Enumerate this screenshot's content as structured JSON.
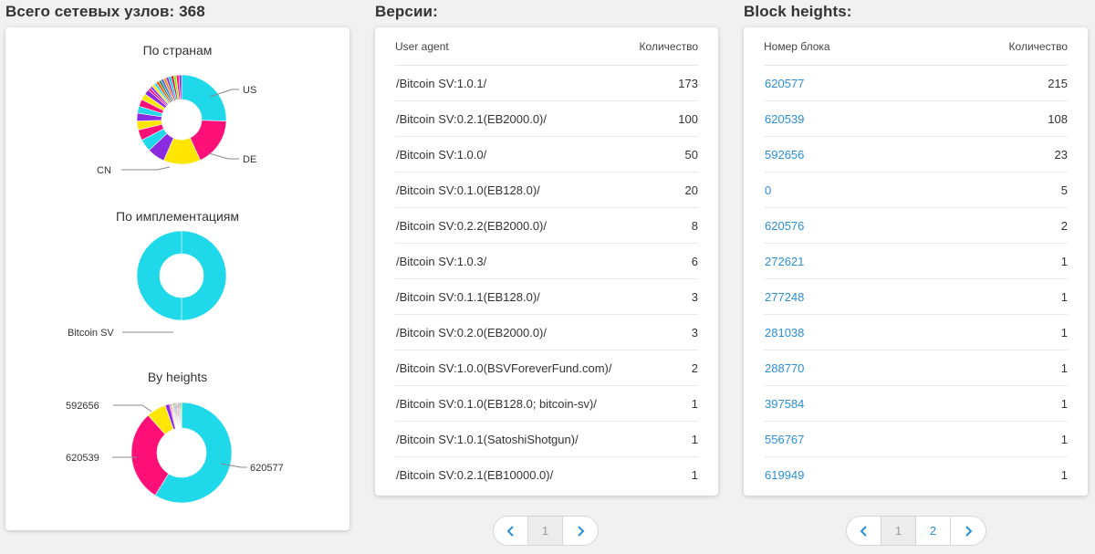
{
  "nodes": {
    "title": "Всего сетевых узлов: 368",
    "charts": [
      {
        "title": "По странам",
        "labels": [
          "US",
          "DE",
          "CN"
        ]
      },
      {
        "title": "По имплементациям",
        "labels": [
          "Bitcoin SV"
        ]
      },
      {
        "title": "By heights",
        "labels": [
          "592656",
          "620539",
          "620577"
        ]
      }
    ]
  },
  "versions": {
    "title": "Версии:",
    "columns": [
      "User agent",
      "Количество"
    ],
    "rows": [
      [
        "/Bitcoin SV:1.0.1/",
        "173"
      ],
      [
        "/Bitcoin SV:0.2.1(EB2000.0)/",
        "100"
      ],
      [
        "/Bitcoin SV:1.0.0/",
        "50"
      ],
      [
        "/Bitcoin SV:0.1.0(EB128.0)/",
        "20"
      ],
      [
        "/Bitcoin SV:0.2.2(EB2000.0)/",
        "8"
      ],
      [
        "/Bitcoin SV:1.0.3/",
        "6"
      ],
      [
        "/Bitcoin SV:0.1.1(EB128.0)/",
        "3"
      ],
      [
        "/Bitcoin SV:0.2.0(EB2000.0)/",
        "3"
      ],
      [
        "/Bitcoin SV:1.0.0(BSVForeverFund.com)/",
        "2"
      ],
      [
        "/Bitcoin SV:0.1.0(EB128.0; bitcoin-sv)/",
        "1"
      ],
      [
        "/Bitcoin SV:1.0.1(SatoshiShotgun)/",
        "1"
      ],
      [
        "/Bitcoin SV:0.2.1(EB10000.0)/",
        "1"
      ]
    ],
    "pages": [
      "1"
    ],
    "prev_icon": "chevron-left-icon",
    "next_icon": "chevron-right-icon"
  },
  "blocks": {
    "title": "Block heights:",
    "columns": [
      "Номер блока",
      "Количество"
    ],
    "rows": [
      [
        "620577",
        "215"
      ],
      [
        "620539",
        "108"
      ],
      [
        "592656",
        "23"
      ],
      [
        "0",
        "5"
      ],
      [
        "620576",
        "2"
      ],
      [
        "272621",
        "1"
      ],
      [
        "277248",
        "1"
      ],
      [
        "281038",
        "1"
      ],
      [
        "288770",
        "1"
      ],
      [
        "397584",
        "1"
      ],
      [
        "556767",
        "1"
      ],
      [
        "619949",
        "1"
      ]
    ],
    "pages": [
      "1",
      "2"
    ]
  },
  "colors": {
    "cyan": "#1fd8ea",
    "pink": "#ff0f78",
    "yellow": "#ffe600",
    "purple": "#8a2be2",
    "link": "#2a8fd8"
  }
}
